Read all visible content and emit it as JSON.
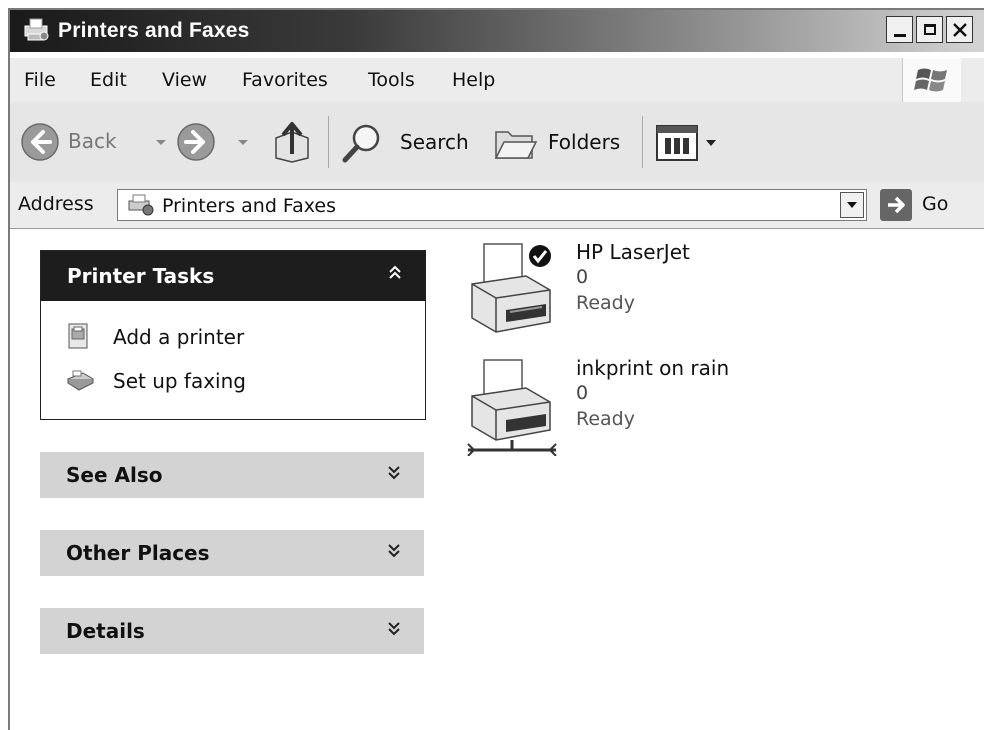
{
  "window": {
    "title": "Printers and Faxes",
    "icon": "printer-icon",
    "buttons": [
      "minimize",
      "maximize",
      "close"
    ]
  },
  "menu": [
    "File",
    "Edit",
    "View",
    "Favorites",
    "Tools",
    "Help"
  ],
  "toolbar": {
    "back_label": "Back",
    "search_label": "Search",
    "folders_label": "Folders"
  },
  "address": {
    "label": "Address",
    "value": "Printers and Faxes",
    "go_label": "Go"
  },
  "sidebar": {
    "printer_tasks": {
      "title": "Printer Tasks",
      "items": [
        {
          "label": "Add a printer",
          "icon": "add-printer-icon"
        },
        {
          "label": "Set up faxing",
          "icon": "fax-icon"
        }
      ]
    },
    "see_also": {
      "title": "See Also"
    },
    "other_places": {
      "title": "Other Places"
    },
    "details": {
      "title": "Details"
    }
  },
  "printers": [
    {
      "name": "HP LaserJet",
      "documents": "0",
      "status": "Ready",
      "default": true,
      "network": false
    },
    {
      "name": "inkprint on rain",
      "documents": "0",
      "status": "Ready",
      "default": false,
      "network": true
    }
  ]
}
